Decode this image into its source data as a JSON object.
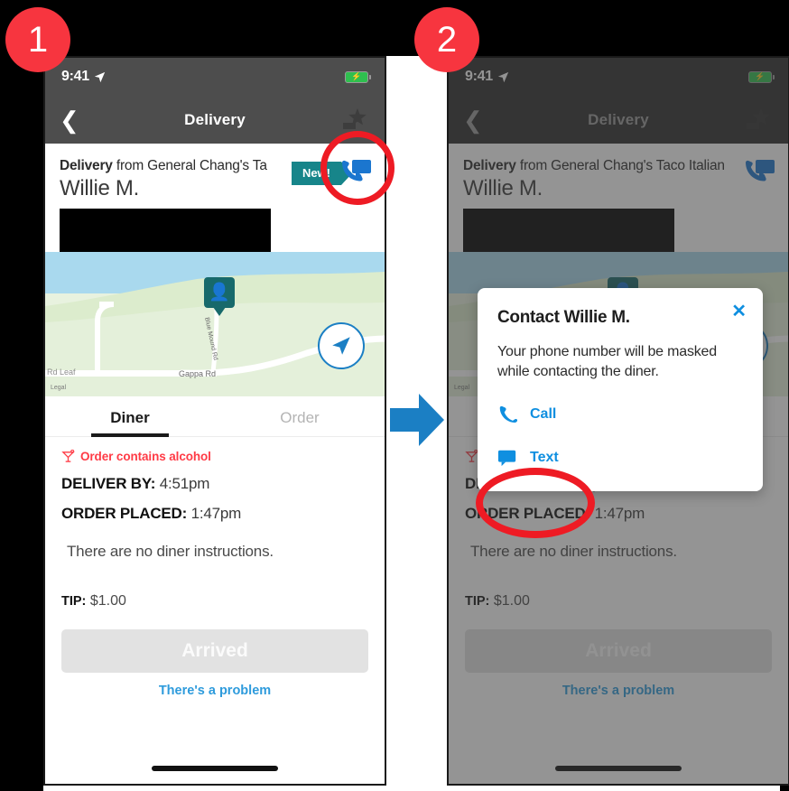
{
  "steps": [
    {
      "number": "1"
    },
    {
      "number": "2"
    }
  ],
  "statusbar": {
    "time": "9:41",
    "location_icon": "location-arrow-icon",
    "battery_icon": "battery-charging-icon"
  },
  "navbar": {
    "back_icon": "chevron-left-icon",
    "title": "Delivery",
    "star_icon": "star-rating-icon"
  },
  "header": {
    "delivery_prefix": "Delivery",
    "delivery_rest_short": " from General Chang's Ta",
    "delivery_rest_full": " from General Chang's Taco Italian",
    "diner_name": "Willie M.",
    "new_badge": "New!",
    "contact_icon": "phone-message-icon"
  },
  "map": {
    "road_label_main": "Gappa Rd",
    "road_label_left": "Rd Leaf",
    "road_label_vertical": "Blue Mound Rd",
    "legal": "Legal",
    "pin_icon": "diner-location-pin-icon",
    "locate_icon": "navigation-arrow-icon",
    "colors": {
      "water": "#a9d9ee",
      "land": "#e8f2df",
      "road": "#ffffff",
      "pin": "#17696b"
    }
  },
  "tabs": [
    {
      "label": "Diner",
      "active": true
    },
    {
      "label": "Order",
      "active": false
    }
  ],
  "details": {
    "alcohol_warning": "Order contains alcohol",
    "alcohol_icon": "cocktail-glass-icon",
    "deliver_by_label": "DELIVER BY:",
    "deliver_by_value": "4:51pm",
    "order_placed_label": "ORDER PLACED:",
    "order_placed_value": "1:47pm",
    "instructions": "There are no diner instructions.",
    "tip_label": "TIP:",
    "tip_value": "$1.00"
  },
  "footer": {
    "arrived_label": "Arrived",
    "problem_label": "There's a problem"
  },
  "modal": {
    "title": "Contact Willie M.",
    "close_icon": "close-icon",
    "body": "Your phone number will be masked while contacting the diner.",
    "actions": [
      {
        "label": "Call",
        "icon": "phone-icon"
      },
      {
        "label": "Text",
        "icon": "chat-bubble-icon"
      }
    ]
  },
  "flow": {
    "arrow_icon": "right-arrow-icon",
    "accent": "#1b7fc4",
    "annotation_color": "#ee1b24"
  }
}
